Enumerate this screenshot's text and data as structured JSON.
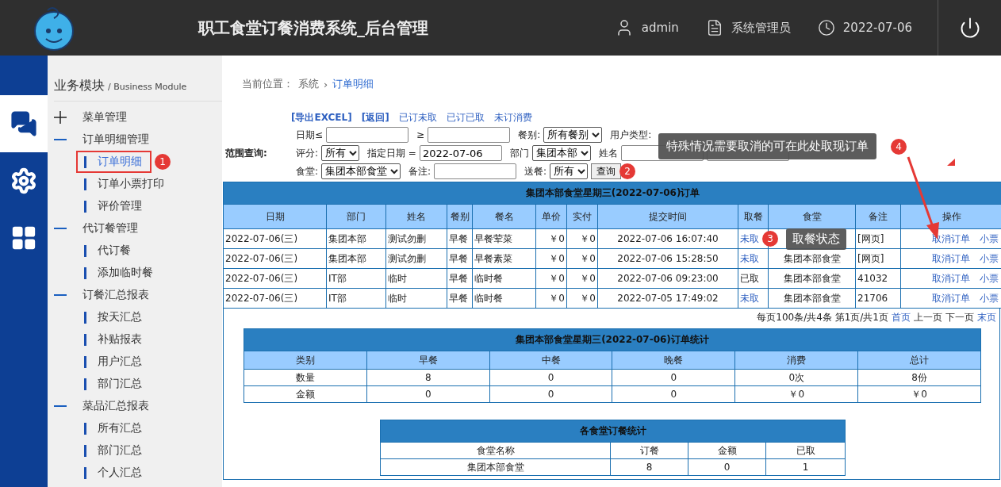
{
  "header": {
    "title": "职工食堂订餐消费系统_后台管理",
    "user": "admin",
    "role": "系统管理员",
    "date": "2022-07-06"
  },
  "rail": [
    {
      "kind": "chat",
      "selected": true
    },
    {
      "kind": "gear",
      "selected": false
    },
    {
      "kind": "grid",
      "selected": false
    }
  ],
  "sidebar": {
    "title": "业务模块",
    "subtitle": "/ Business Module",
    "groups": [
      {
        "label": "菜单管理",
        "expanded": false
      },
      {
        "label": "订单明细管理",
        "expanded": true,
        "children": [
          {
            "label": "订单明细",
            "selected": true,
            "highlighted": true,
            "badge": "1"
          },
          {
            "label": "订单小票打印",
            "selected": false
          },
          {
            "label": "评价管理",
            "selected": false
          }
        ]
      },
      {
        "label": "代订餐管理",
        "expanded": true,
        "children": [
          {
            "label": "代订餐",
            "selected": false
          },
          {
            "label": "添加临时餐",
            "selected": false
          }
        ]
      },
      {
        "label": "订餐汇总报表",
        "expanded": true,
        "children": [
          {
            "label": "按天汇总",
            "selected": false
          },
          {
            "label": "补贴报表",
            "selected": false
          },
          {
            "label": "用户汇总",
            "selected": false
          },
          {
            "label": "部门汇总",
            "selected": false
          }
        ]
      },
      {
        "label": "菜品汇总报表",
        "expanded": true,
        "children": [
          {
            "label": "所有汇总",
            "selected": false
          },
          {
            "label": "部门汇总",
            "selected": false
          },
          {
            "label": "个人汇总",
            "selected": false
          }
        ]
      }
    ]
  },
  "breadcrumb": {
    "label": "当前位置：",
    "items": [
      "系统",
      "订单明细"
    ],
    "separator": "›"
  },
  "links": [
    {
      "kind": "action",
      "label": "[导出EXCEL]"
    },
    {
      "kind": "action",
      "label": "[返回]"
    },
    {
      "kind": "filter",
      "label": "已订未取"
    },
    {
      "kind": "filter",
      "label": "已订已取"
    },
    {
      "kind": "filter",
      "label": "未订消费"
    }
  ],
  "filters": {
    "scope_label": "范围查询:",
    "rows": [
      [
        {
          "kind": "label",
          "text": "日期≤"
        },
        {
          "kind": "input"
        },
        {
          "kind": "label",
          "text": "≥"
        },
        {
          "kind": "input"
        },
        {
          "kind": "label",
          "text": "餐别:"
        },
        {
          "kind": "select",
          "value": "所有餐别"
        },
        {
          "kind": "label",
          "text": "用户类型:"
        }
      ],
      [
        {
          "kind": "label",
          "text": "评分:"
        },
        {
          "kind": "select",
          "value": "所有"
        },
        {
          "kind": "label",
          "text": "指定日期 ="
        },
        {
          "kind": "input",
          "value": "2022-07-06"
        },
        {
          "kind": "label",
          "text": "部门"
        },
        {
          "kind": "select",
          "value": "集团本部"
        },
        {
          "kind": "label",
          "text": "姓名"
        },
        {
          "kind": "input"
        },
        {
          "kind": "input"
        }
      ],
      [
        {
          "kind": "label",
          "text": "食堂:"
        },
        {
          "kind": "select",
          "value": "集团本部食堂"
        },
        {
          "kind": "label",
          "text": "备注:"
        },
        {
          "kind": "input"
        },
        {
          "kind": "label",
          "text": "送餐:"
        },
        {
          "kind": "select",
          "value": "所有"
        },
        {
          "kind": "button",
          "text": "查询",
          "badge": "2"
        }
      ]
    ]
  },
  "callout": {
    "badge": "4",
    "text": "特殊情况需要取消的可在此处取现订单"
  },
  "main_table": {
    "title": "集团本部食堂星期三(2022-07-06)订单",
    "columns": [
      "日期",
      "部门",
      "姓名",
      "餐别",
      "餐名",
      "单价",
      "实付",
      "提交时间",
      "取餐",
      "食堂",
      "备注",
      "操作"
    ],
    "rows": [
      {
        "date": "2022-07-06(三)",
        "dept": "集团本部",
        "name": "测试勿删",
        "meal": "早餐",
        "dish": "早餐荤菜",
        "price": "￥0",
        "paid": "￥0",
        "time": "2022-07-06 16:07:40",
        "pickup": "未取",
        "picked_up": false,
        "note": "[网页]",
        "actions": [
          "取消订单",
          "小票"
        ],
        "badge": "3",
        "tip": "取餐状态"
      },
      {
        "date": "2022-07-06(三)",
        "dept": "集团本部",
        "name": "测试勿删",
        "meal": "早餐",
        "dish": "早餐素菜",
        "price": "￥0",
        "paid": "￥0",
        "time": "2022-07-06 15:28:50",
        "pickup": "未取",
        "picked_up": false,
        "canteen": "集团本部食堂",
        "note": "[网页]",
        "actions": [
          "取消订单",
          "小票"
        ]
      },
      {
        "date": "2022-07-06(三)",
        "dept": "IT部",
        "name": "临时",
        "meal": "早餐",
        "dish": "临时餐",
        "price": "￥0",
        "paid": "￥0",
        "time": "2022-07-06 09:23:00",
        "pickup": "已取",
        "picked_up": true,
        "canteen": "集团本部食堂",
        "note": "41032",
        "actions": [
          "取消订单",
          "小票"
        ]
      },
      {
        "date": "2022-07-06(三)",
        "dept": "IT部",
        "name": "临时",
        "meal": "早餐",
        "dish": "临时餐",
        "price": "￥0",
        "paid": "￥0",
        "time": "2022-07-05 17:49:02",
        "pickup": "未取",
        "picked_up": false,
        "canteen": "集团本部食堂",
        "note": "21706",
        "actions": [
          "取消订单",
          "小票"
        ]
      }
    ]
  },
  "pagination": {
    "summary": "每页100条/共4条 第1页/共1页",
    "links": [
      {
        "label": "首页",
        "disabled": false
      },
      {
        "label": "上一页",
        "disabled": true
      },
      {
        "label": "下一页",
        "disabled": true
      },
      {
        "label": "末页",
        "disabled": false
      }
    ]
  },
  "stats_table": {
    "title": "集团本部食堂星期三(2022-07-06)订单统计",
    "columns": [
      "类别",
      "早餐",
      "中餐",
      "晚餐",
      "消费",
      "总计"
    ],
    "rows": [
      [
        "数量",
        "8",
        "0",
        "0",
        "0次",
        "8份"
      ],
      [
        "金额",
        "0",
        "0",
        "0",
        "￥0",
        "￥0"
      ]
    ]
  },
  "canteen_table": {
    "title": "各食堂订餐统计",
    "columns": [
      "食堂名称",
      "订餐",
      "金额",
      "已取"
    ],
    "rows": [
      [
        "集团本部食堂",
        "8",
        "0",
        "1"
      ]
    ]
  }
}
